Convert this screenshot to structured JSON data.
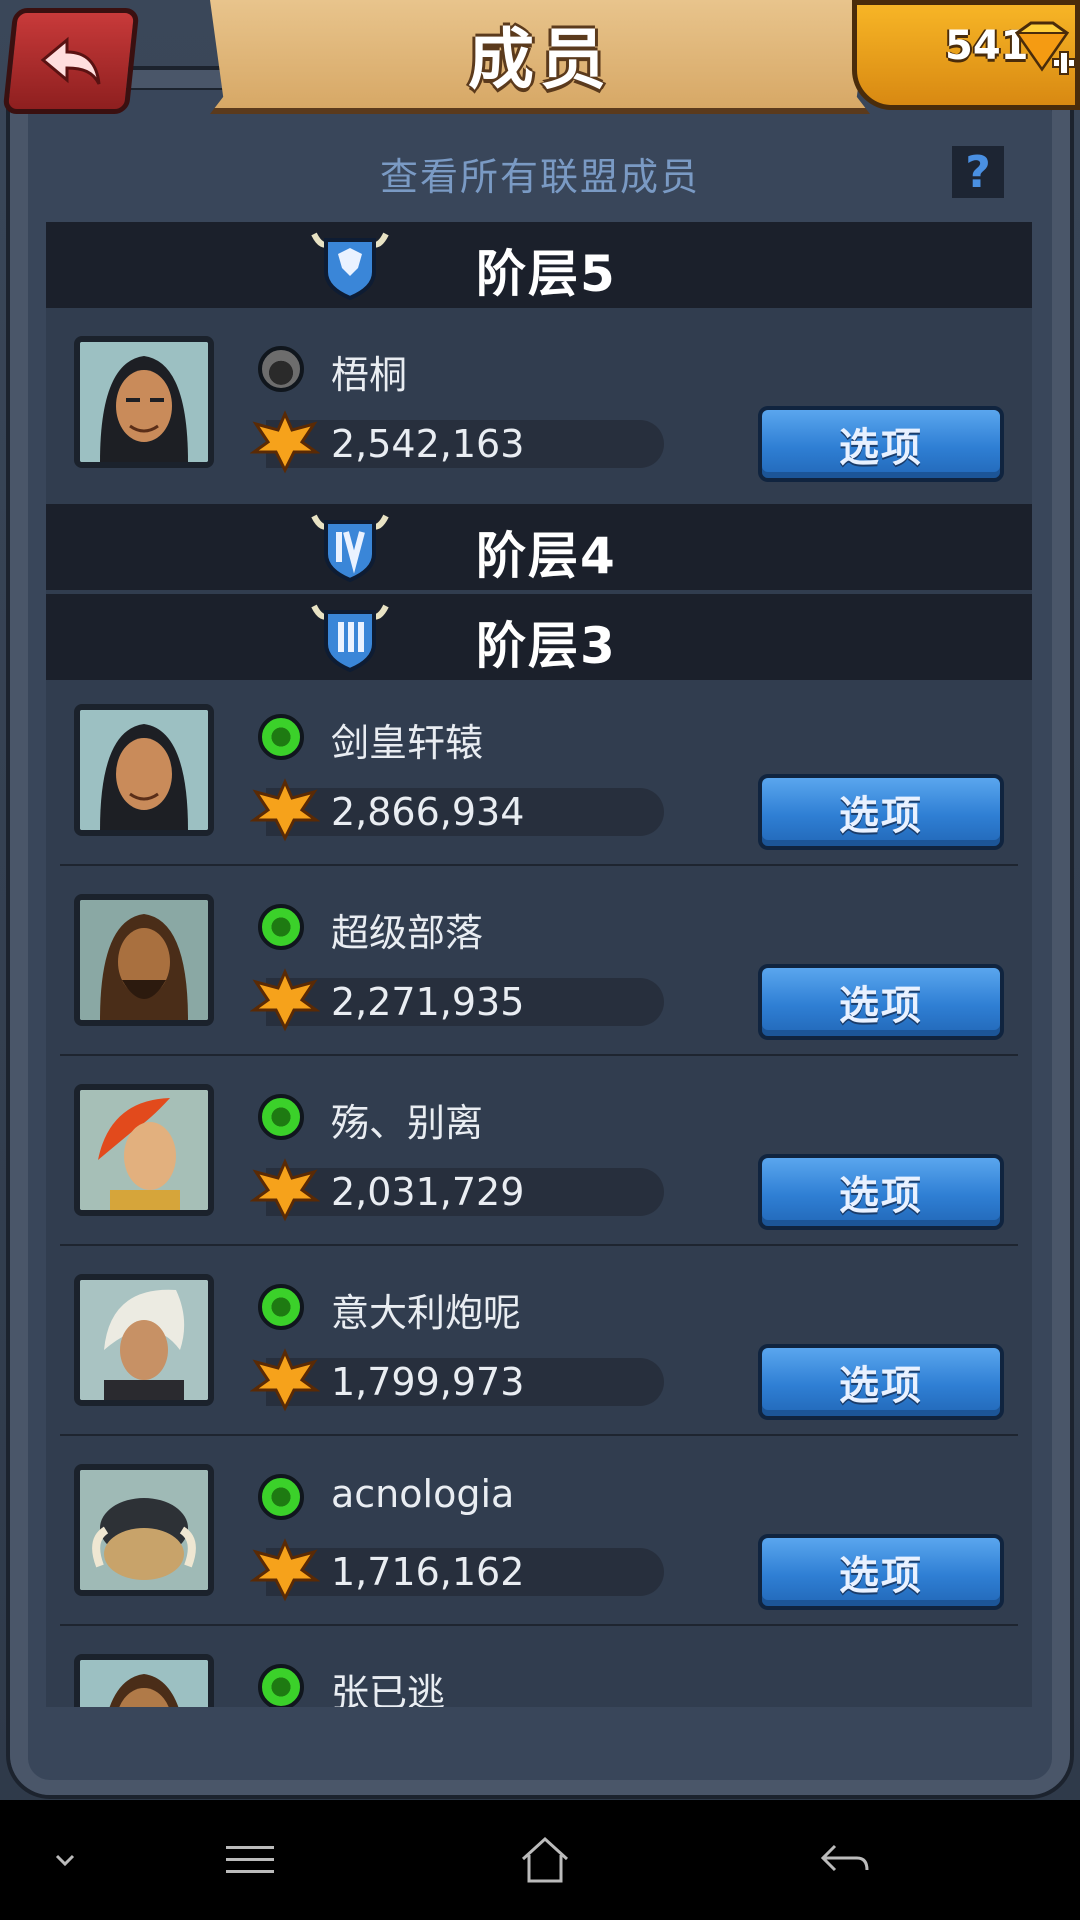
{
  "header": {
    "title": "成员",
    "gems": "541"
  },
  "subtitle": "查看所有联盟成员",
  "help_label": "?",
  "tiers": [
    {
      "label": "阶层5",
      "badge": "shield-icon"
    },
    {
      "label": "阶层4",
      "badge": "tier-iv-shield-icon"
    },
    {
      "label": "阶层3",
      "badge": "tier-iii-shield-icon"
    }
  ],
  "members": [
    {
      "name": "梧桐",
      "score": "2,542,163",
      "status": "offline",
      "option": "选项"
    },
    {
      "name": "剑皇轩辕",
      "score": "2,866,934",
      "status": "online",
      "option": "选项"
    },
    {
      "name": "超级部落",
      "score": "2,271,935",
      "status": "online",
      "option": "选项"
    },
    {
      "name": "殇、别离",
      "score": "2,031,729",
      "status": "online",
      "option": "选项"
    },
    {
      "name": "意大利炮呢",
      "score": "1,799,973",
      "status": "online",
      "option": "选项"
    },
    {
      "name": "acnologia",
      "score": "1,716,162",
      "status": "online",
      "option": "选项"
    },
    {
      "name": "张已逃",
      "score": "",
      "status": "online",
      "option": ""
    }
  ],
  "colors": {
    "accent_blue": "#2f7fd4",
    "online": "#3bd12a",
    "offline": "#6d6d6d",
    "gold": "#f7b526"
  }
}
